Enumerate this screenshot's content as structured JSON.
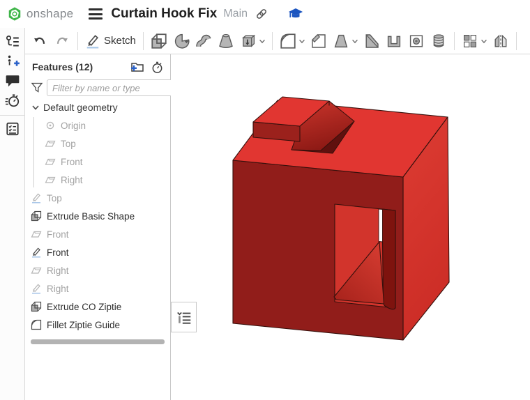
{
  "header": {
    "logo_text": "onshape",
    "title": "Curtain Hook Fix",
    "branch": "Main",
    "icons": [
      "onshape-logo",
      "hamburger-menu-icon",
      "share-link-icon",
      "education-cap-icon"
    ]
  },
  "toolbar": {
    "undo_icon": "undo-arrow",
    "redo_icon": "redo-arrow",
    "sketch_label": "Sketch",
    "tool_icons": [
      "extrude",
      "revolve",
      "sweep",
      "loft",
      "thicken",
      "fillet",
      "chamfer",
      "draft",
      "rib",
      "shell",
      "hole",
      "thread",
      "linear-pattern",
      "mirror"
    ]
  },
  "left_rail": {
    "icons": [
      "feature-list",
      "insert-new",
      "comments",
      "history-stopwatch",
      "checklist"
    ]
  },
  "feature_panel": {
    "title": "Features (12)",
    "new_folder_icon": "new-folder",
    "rollback_icon": "stopwatch",
    "filter_placeholder": "Filter by name or type",
    "rows": [
      {
        "label": "Default geometry",
        "icon": "chevron-down",
        "muted": false
      },
      {
        "label": "Origin",
        "icon": "origin",
        "muted": true
      },
      {
        "label": "Top",
        "icon": "plane",
        "muted": true
      },
      {
        "label": "Front",
        "icon": "plane",
        "muted": true
      },
      {
        "label": "Right",
        "icon": "plane",
        "muted": true
      },
      {
        "label": "Top",
        "icon": "sketch",
        "muted": true
      },
      {
        "label": "Extrude Basic Shape",
        "icon": "extrude",
        "muted": false
      },
      {
        "label": "Front",
        "icon": "plane",
        "muted": true
      },
      {
        "label": "Front",
        "icon": "sketch",
        "muted": false
      },
      {
        "label": "Right",
        "icon": "plane",
        "muted": true
      },
      {
        "label": "Right",
        "icon": "sketch",
        "muted": true
      },
      {
        "label": "Extrude CO Ziptie",
        "icon": "extrude",
        "muted": false
      },
      {
        "label": "Fillet Ziptie Guide",
        "icon": "fillet",
        "muted": false
      }
    ]
  },
  "model": {
    "description": "red cube part with top notch pocket and front ziptie pocket",
    "colors": {
      "top": "#e13631",
      "front": "#911d1a",
      "right": "#d8362e",
      "ledge_wall": "#9b211c",
      "pocket_dark": "#5f100e",
      "far_wall": "#d2342c",
      "inner_wall_dark": "#7e130e",
      "slot": "#ffffff",
      "edge": "#35100c"
    }
  }
}
